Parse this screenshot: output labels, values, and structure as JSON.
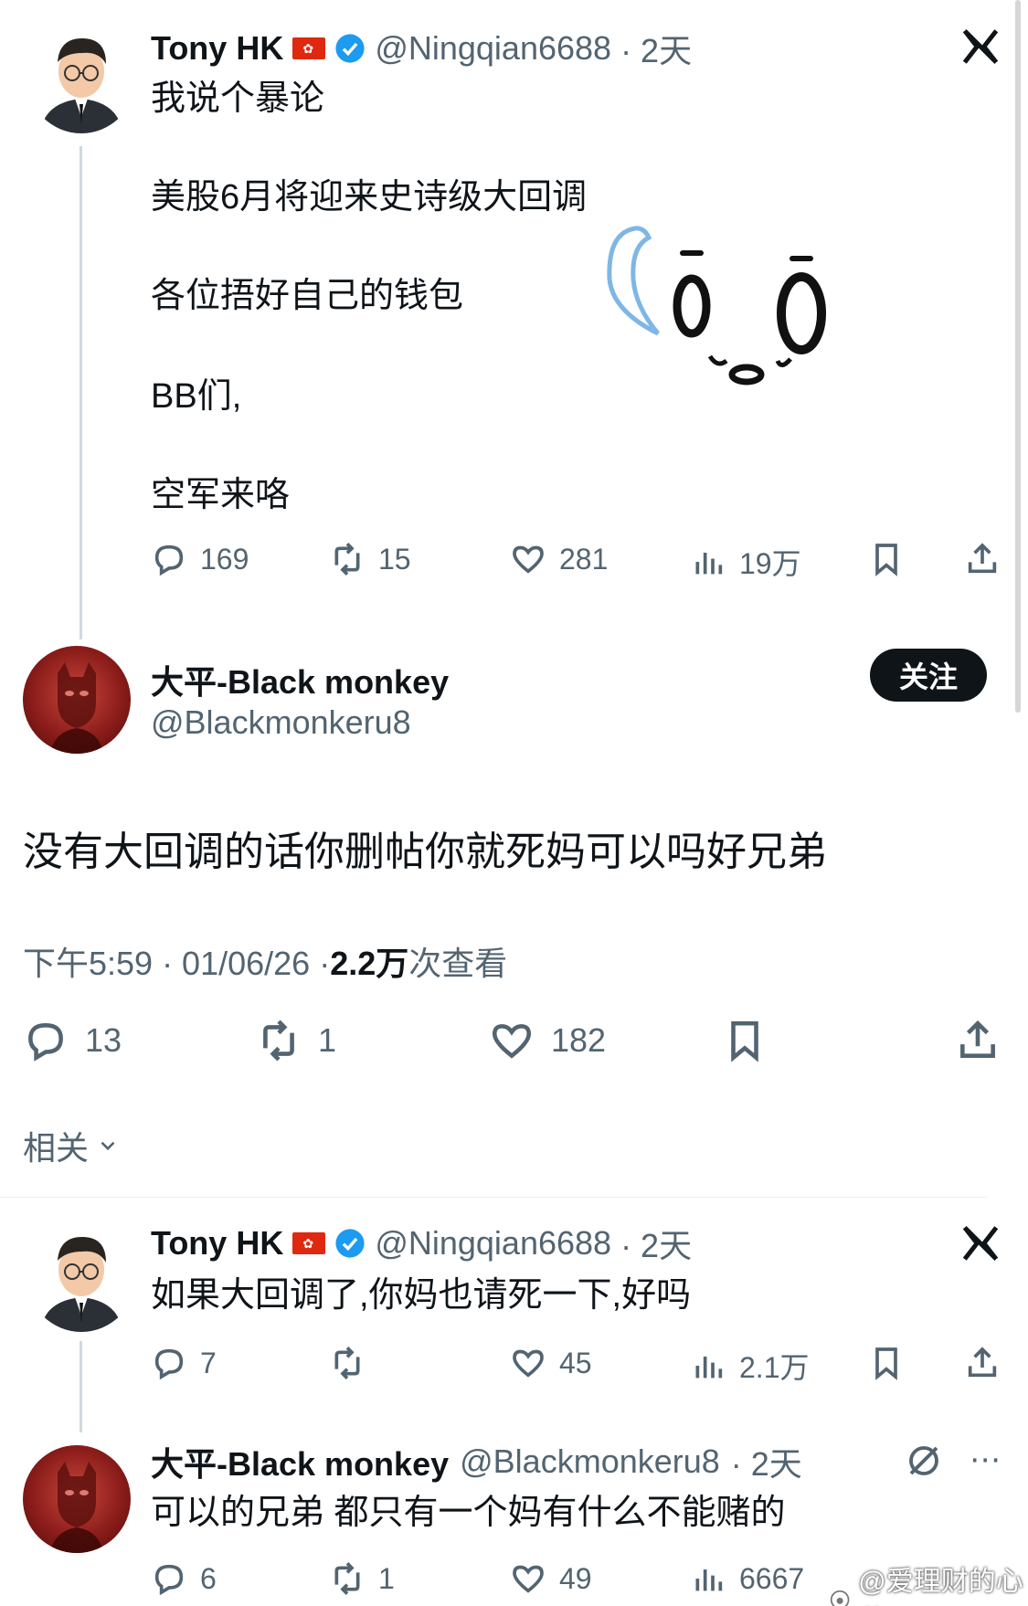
{
  "post1": {
    "name": "Tony HK",
    "handle": "@Ningqian6688",
    "time": "· 2天",
    "lines": [
      "我说个暴论",
      "美股6月将迎来史诗级大回调",
      "各位捂好自己的钱包",
      "BB们,",
      "空军来咯"
    ],
    "stats": {
      "replies": "169",
      "reposts": "15",
      "likes": "281",
      "views": "19万"
    }
  },
  "post2": {
    "name": "大平-Black monkey",
    "handle": "@Blackmonkeru8",
    "follow_label": "关注",
    "text": "没有大回调的话你删帖你就死妈可以吗好兄弟",
    "meta_time": "下午5:59 · 01/06/26 · ",
    "meta_views": "2.2万",
    "meta_views_label": " 次查看",
    "stats": {
      "replies": "13",
      "reposts": "1",
      "likes": "182"
    },
    "related_label": "相关"
  },
  "post3": {
    "name": "Tony HK",
    "handle": "@Ningqian6688",
    "time": "· 2天",
    "text": "如果大回调了,你妈也请死一下,好吗",
    "stats": {
      "replies": "7",
      "reposts": "",
      "likes": "45",
      "views": "2.1万"
    }
  },
  "post4": {
    "name": "大平-Black monkey",
    "handle": "@Blackmonkeru8",
    "time": "· 2天",
    "text": "可以的兄弟 都只有一个妈有什么不能赌的",
    "stats": {
      "replies": "6",
      "reposts": "1",
      "likes": "49",
      "views": "6667"
    }
  },
  "watermark": "@爱理财的心蓝"
}
